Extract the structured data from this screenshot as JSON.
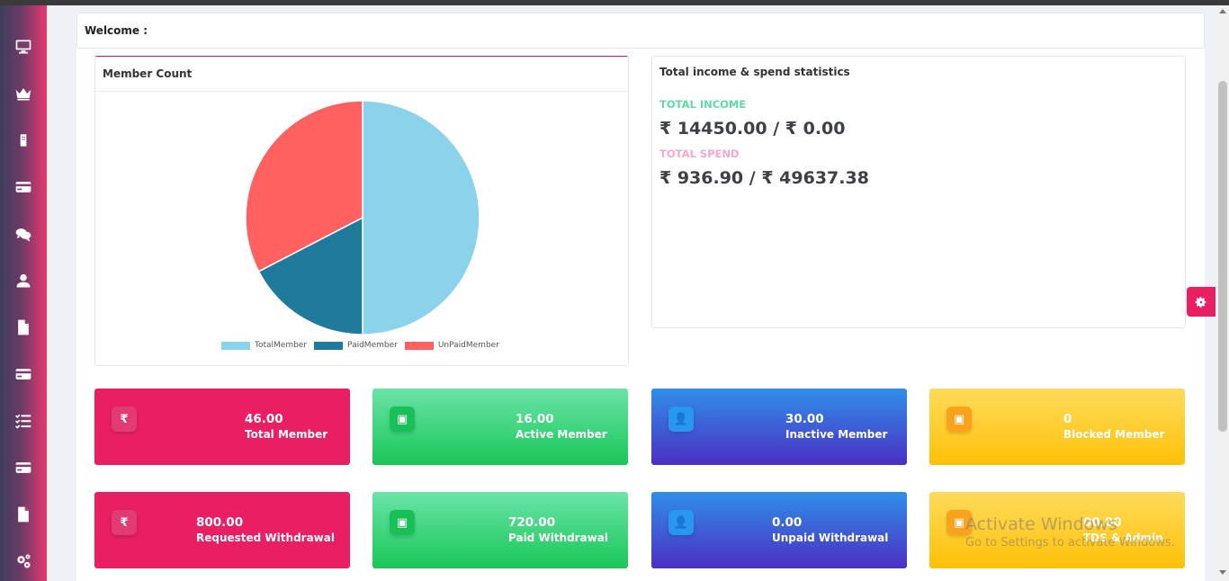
{
  "sidebar": {
    "items": [
      {
        "icon": "monitor-icon"
      },
      {
        "icon": "crown-icon"
      },
      {
        "icon": "building-icon"
      },
      {
        "icon": "credit-card-icon"
      },
      {
        "icon": "comments-icon"
      },
      {
        "icon": "user-icon"
      },
      {
        "icon": "file-icon"
      },
      {
        "icon": "credit-card-icon"
      },
      {
        "icon": "tasks-icon"
      },
      {
        "icon": "credit-card-icon"
      },
      {
        "icon": "file-icon"
      },
      {
        "icon": "cogs-icon"
      }
    ]
  },
  "header": {
    "welcome": "Welcome :"
  },
  "member_count": {
    "title": "Member Count"
  },
  "chart_data": {
    "type": "pie",
    "categories": [
      "TotalMember",
      "PaidMember",
      "UnPaidMember"
    ],
    "values": [
      46,
      16,
      30
    ],
    "colors": [
      "#8bd3eb",
      "#1f7a9b",
      "#ff6160"
    ],
    "legend": "bottom"
  },
  "income": {
    "title": "Total income & spend statistics",
    "income_label": "TOTAL INCOME",
    "income_value": "₹ 14450.00 / ₹ 0.00",
    "spend_label": "TOTAL SPEND",
    "spend_value": "₹ 936.90 / ₹ 49637.38",
    "income_color": "#5fdba8",
    "spend_color": "#f7a8cd"
  },
  "stats": [
    {
      "value": "46.00",
      "label": "Total Member",
      "icon_symbol": "₹",
      "icon": "rupee-icon",
      "color": "pink"
    },
    {
      "value": "16.00",
      "label": "Active Member",
      "icon_symbol": "▣",
      "icon": "money-icon",
      "color": "green"
    },
    {
      "value": "30.00",
      "label": "Inactive Member",
      "icon_symbol": "👤",
      "icon": "user-plus-icon",
      "color": "blue"
    },
    {
      "value": "0",
      "label": "Blocked Member",
      "icon_symbol": "▣",
      "icon": "money-icon",
      "color": "yellow"
    },
    {
      "value": "800.00",
      "label": "Requested Withdrawal",
      "icon_symbol": "₹",
      "icon": "rupee-icon",
      "color": "pink"
    },
    {
      "value": "720.00",
      "label": "Paid Withdrawal",
      "icon_symbol": "▣",
      "icon": "money-icon",
      "color": "green"
    },
    {
      "value": "0.00",
      "label": "Unpaid Withdrawal",
      "icon_symbol": "👤",
      "icon": "user-plus-icon",
      "color": "blue"
    },
    {
      "value": "00.00",
      "label": "TDS & Admin",
      "icon_symbol": "▣",
      "icon": "money-icon",
      "color": "yellow"
    }
  ],
  "watermark": {
    "line1": "Activate Windows",
    "line2": "Go to Settings to activate Windows."
  }
}
